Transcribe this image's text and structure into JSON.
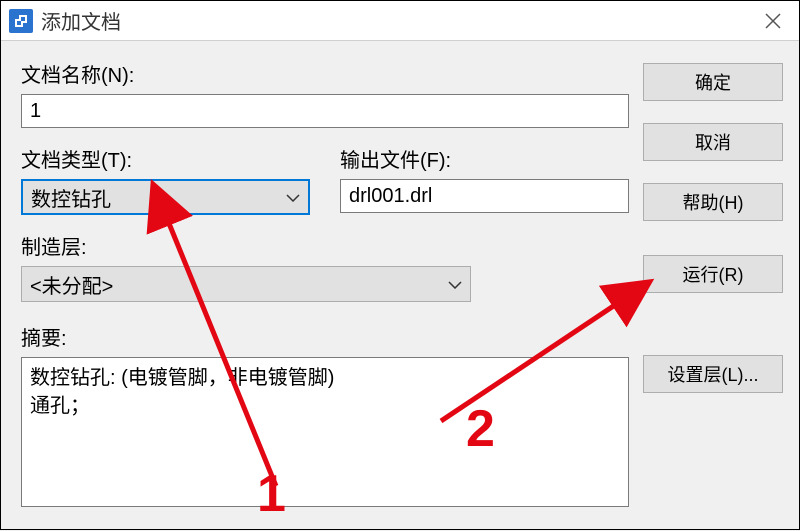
{
  "window": {
    "title": "添加文档"
  },
  "labels": {
    "doc_name": "文档名称(N):",
    "doc_type": "文档类型(T):",
    "output_file": "输出文件(F):",
    "mfg_layer": "制造层:",
    "summary": "摘要:"
  },
  "values": {
    "doc_name": "1",
    "doc_type": "数控钻孔",
    "output_file": "drl001.drl",
    "mfg_layer": "<未分配>",
    "summary": "数控钻孔: (电镀管脚，非电镀管脚)\n通孔；"
  },
  "buttons": {
    "ok": "确定",
    "cancel": "取消",
    "help": "帮助(H)",
    "run": "运行(R)",
    "set_layer": "设置层(L)..."
  },
  "annotations": {
    "one": "1",
    "two": "2"
  }
}
